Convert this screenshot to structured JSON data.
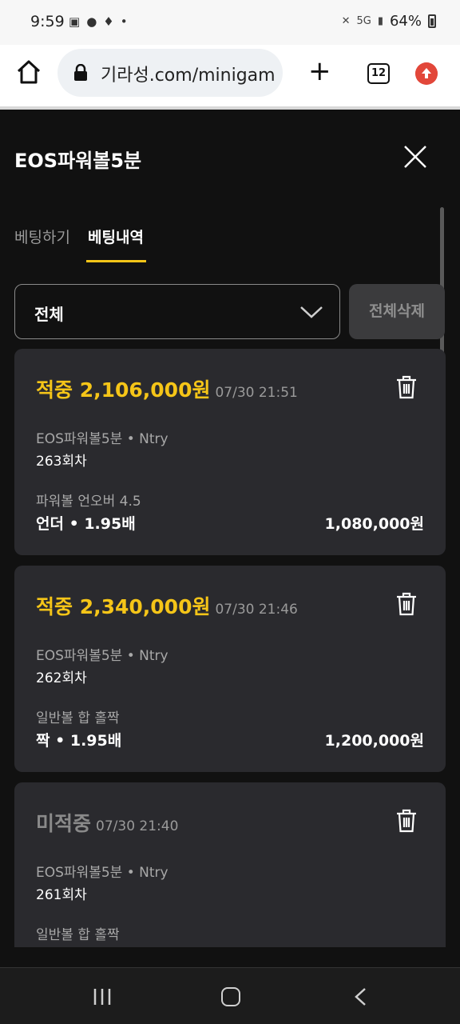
{
  "status_bar": {
    "time": "9:59",
    "battery": "64%",
    "network": "5G"
  },
  "browser": {
    "url": "기라성.com/minigam",
    "tab_count": "12"
  },
  "modal": {
    "title": "EOS파워볼5분",
    "tabs": [
      {
        "label": "베팅하기",
        "active": false
      },
      {
        "label": "베팅내역",
        "active": true
      }
    ],
    "filter": {
      "selected": "전체"
    },
    "delete_all_label": "전체삭제"
  },
  "bets": [
    {
      "status": "적중 2,106,000원",
      "result": "hit",
      "time": "07/30 21:51",
      "game": "EOS파워볼5분 • Ntry",
      "round": "263회차",
      "market": "파워볼 언오버 4.5",
      "pick": "언더 • 1.95배",
      "amount": "1,080,000원"
    },
    {
      "status": "적중 2,340,000원",
      "result": "hit",
      "time": "07/30 21:46",
      "game": "EOS파워볼5분 • Ntry",
      "round": "262회차",
      "market": "일반볼 합 홀짝",
      "pick": "짝 • 1.95배",
      "amount": "1,200,000원"
    },
    {
      "status": "미적중",
      "result": "miss",
      "time": "07/30 21:40",
      "game": "EOS파워볼5분 • Ntry",
      "round": "261회차",
      "market": "일반볼 합 홀짝",
      "pick": "",
      "amount": ""
    }
  ],
  "colors": {
    "accent": "#f5c518",
    "background": "#111111",
    "card": "#2a2a2e",
    "update_badge": "#e2473a"
  }
}
